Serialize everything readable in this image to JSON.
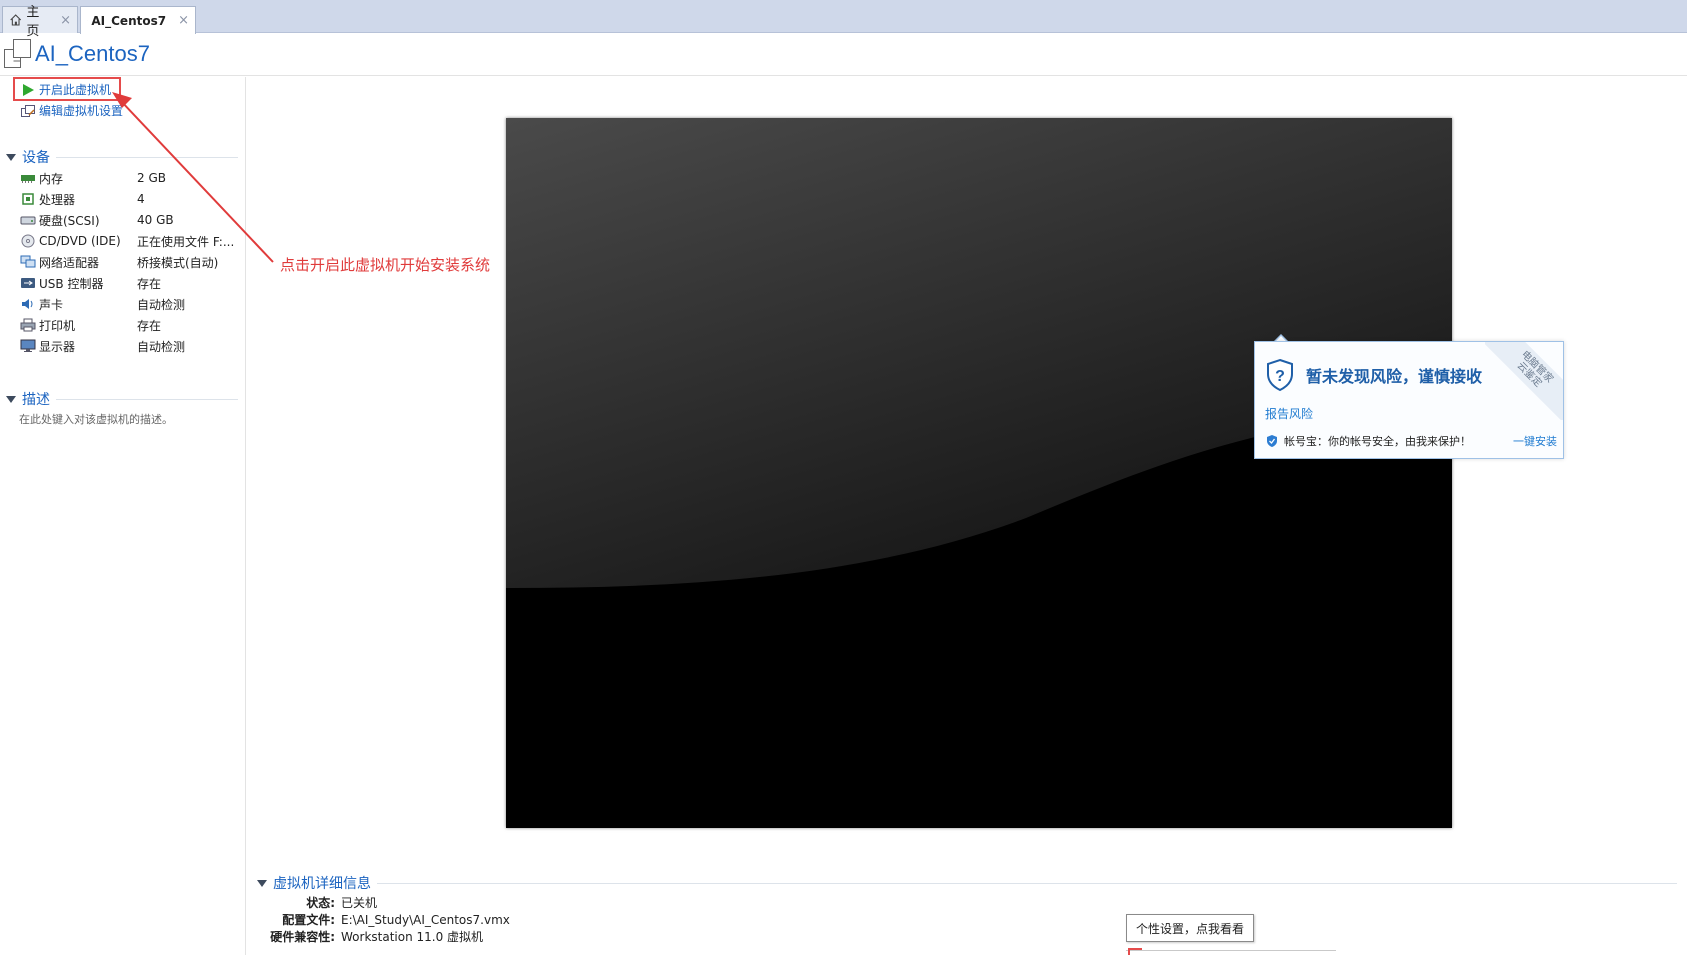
{
  "tabs": [
    {
      "label": "主页",
      "icon": "home-icon",
      "close": "×"
    },
    {
      "label": "AI_Centos7",
      "icon": "vm-icon",
      "close": "×"
    }
  ],
  "vm": {
    "title": "AI_Centos7"
  },
  "actions": {
    "power_on": "开启此虚拟机",
    "edit_settings": "编辑虚拟机设置"
  },
  "devices": {
    "heading": "设备",
    "items": [
      {
        "name": "内存",
        "value": "2 GB",
        "icon": "memory-icon"
      },
      {
        "name": "处理器",
        "value": "4",
        "icon": "cpu-icon"
      },
      {
        "name": "硬盘(SCSI)",
        "value": "40 GB",
        "icon": "harddisk-icon"
      },
      {
        "name": "CD/DVD (IDE)",
        "value": "正在使用文件 F:...",
        "icon": "cd-icon"
      },
      {
        "name": "网络适配器",
        "value": "桥接模式(自动)",
        "icon": "network-icon"
      },
      {
        "name": "USB 控制器",
        "value": "存在",
        "icon": "usb-icon"
      },
      {
        "name": "声卡",
        "value": "自动检测",
        "icon": "sound-icon"
      },
      {
        "name": "打印机",
        "value": "存在",
        "icon": "printer-icon"
      },
      {
        "name": "显示器",
        "value": "自动检测",
        "icon": "monitor-icon"
      }
    ]
  },
  "description": {
    "heading": "描述",
    "placeholder": "在此处键入对该虚拟机的描述。"
  },
  "annotation": {
    "text": "点击开启此虚拟机开始安装系统",
    "color": "#e03b3b"
  },
  "popup": {
    "title": "暂未发现风险，谨慎接收",
    "report_link": "报告风险",
    "account_text": "帐号宝：你的帐号安全，由我来保护！",
    "install_link": "一键安装",
    "ribbon": "电脑管家\n云鉴定"
  },
  "details": {
    "heading": "虚拟机详细信息",
    "rows": [
      {
        "key": "状态:",
        "value": "已关机"
      },
      {
        "key": "配置文件:",
        "value": "E:\\AI_Study\\AI_Centos7.vmx"
      },
      {
        "key": "硬件兼容性:",
        "value": "Workstation 11.0 虚拟机"
      }
    ]
  },
  "tooltip": {
    "text": "个性设置，点我看看"
  },
  "colors": {
    "accent": "#1c64c0",
    "annotation_red": "#e03b3b",
    "tab_strip": "#cfd8ea"
  }
}
